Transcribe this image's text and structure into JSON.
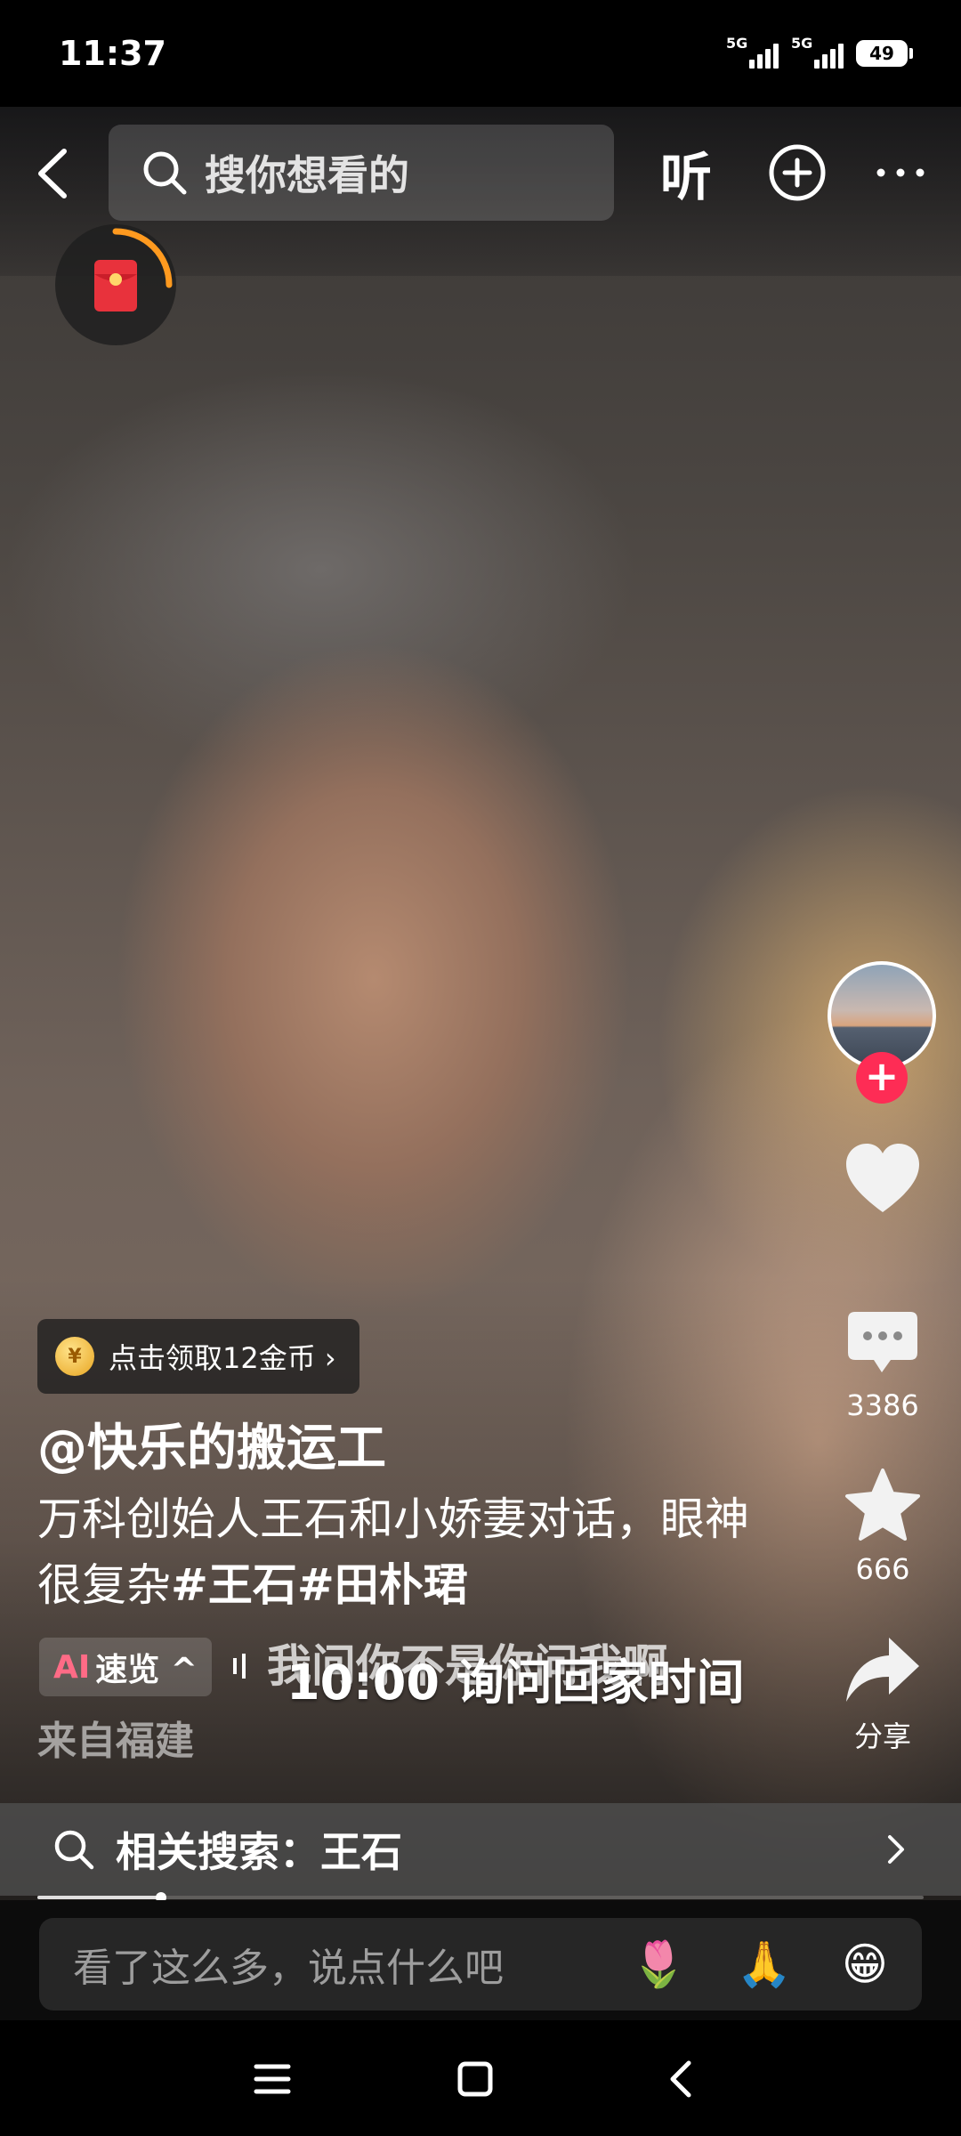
{
  "status_bar": {
    "time": "11:37",
    "network_1": "5G",
    "network_2": "5G",
    "battery": "49"
  },
  "top_bar": {
    "search_placeholder": "搜你想看的",
    "listen_label": "听"
  },
  "right_rail": {
    "comments_count": "3386",
    "favorites_count": "666",
    "share_label": "分享"
  },
  "bottom_info": {
    "coin_reward": "点击领取12金币 ›",
    "author": "@快乐的搬运工",
    "description_text": "万科创始人王石和小娇妻对话，眼神很复杂",
    "tag_1": "#王石",
    "tag_2": "#田朴珺",
    "ai_label_prefix": "AI",
    "ai_label": "速览 ^",
    "subtitle_back": "我问你不是你问我啊",
    "subtitle_front": "10:00 询问回家时间",
    "location": "来自福建"
  },
  "related_search": {
    "label": "相关搜索：王石"
  },
  "progress": {
    "fraction": 0.14
  },
  "comment_bar": {
    "placeholder": "看了这么多，说点什么吧",
    "emoji_1": "🌷",
    "emoji_2": "🙏",
    "emoji_3": "😁"
  },
  "colors": {
    "accent": "#fe2c55",
    "coin": "#e8a521",
    "redpacket": "#e8323c"
  }
}
